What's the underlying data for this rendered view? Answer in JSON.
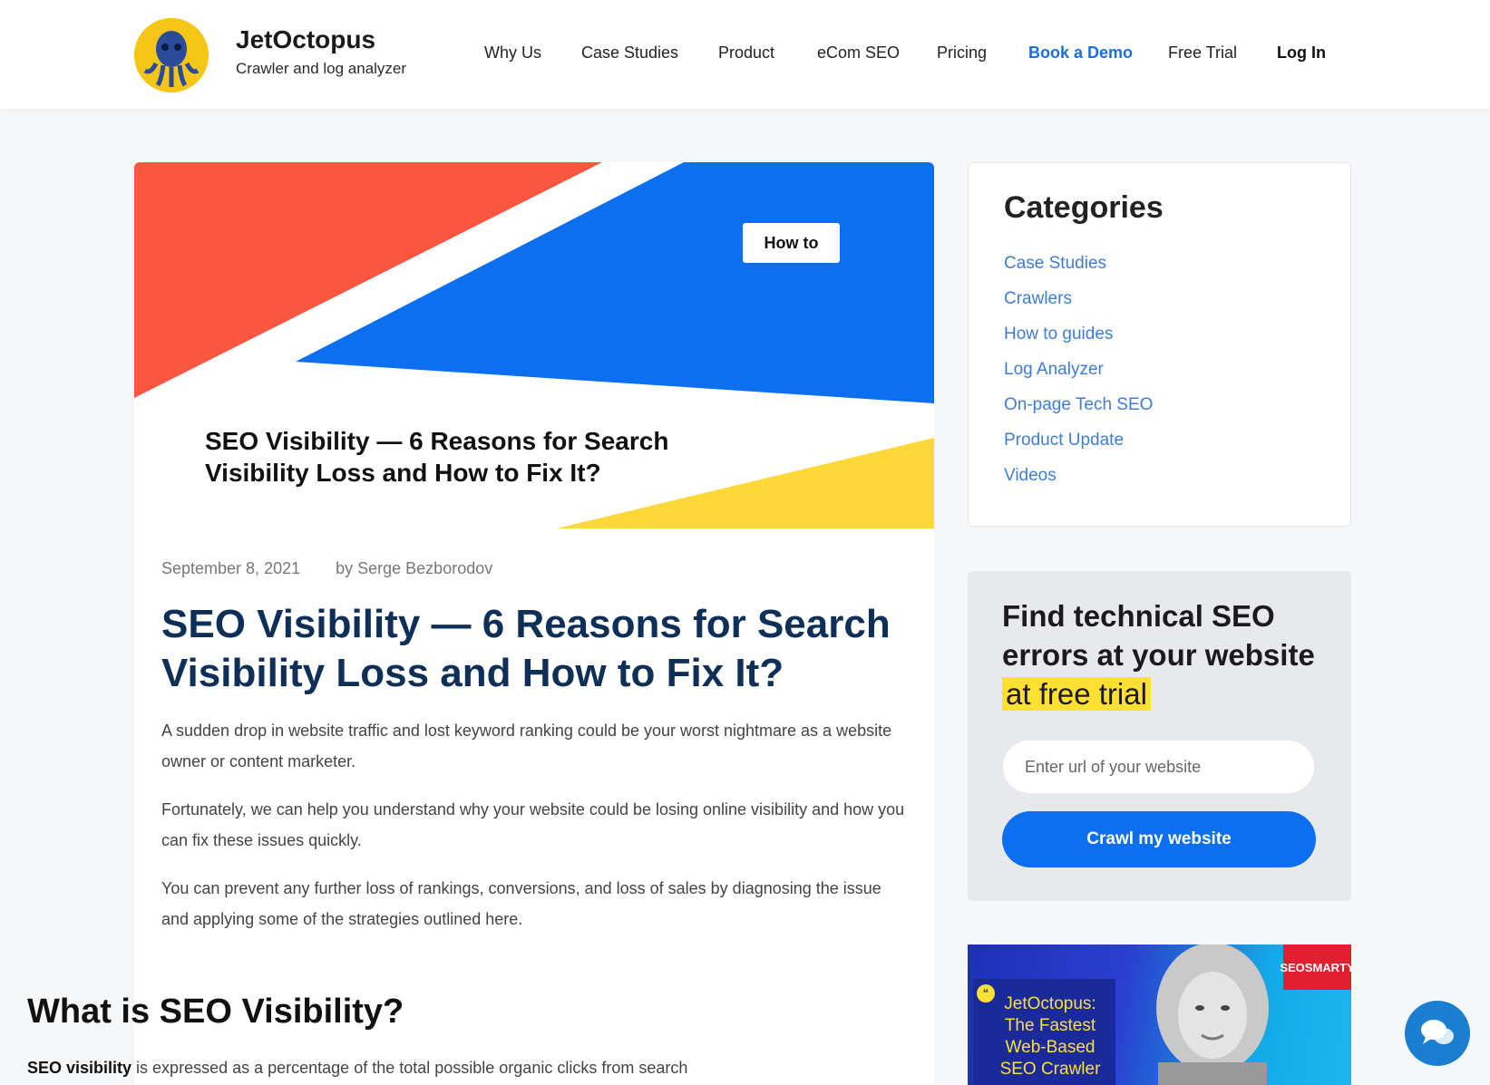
{
  "brand": {
    "name": "JetOctopus",
    "tagline": "Crawler and log analyzer"
  },
  "nav": {
    "items": [
      "Why Us",
      "Case Studies",
      "Product",
      "eCom SEO",
      "Pricing"
    ],
    "book_demo": "Book a Demo",
    "free_trial": "Free Trial",
    "log_in": "Log In"
  },
  "hero": {
    "badge": "How to",
    "title": "SEO Visibility — 6 Reasons for Search Visibility Loss and How to Fix It?"
  },
  "article": {
    "date": "September 8, 2021",
    "author": "by Serge Bezborodov",
    "title": "SEO Visibility — 6 Reasons for Search Visibility Loss and How to Fix It?",
    "paragraphs": [
      "A sudden drop in website traffic and lost keyword ranking could be your worst nightmare as a website owner or content marketer.",
      "Fortunately, we can help you understand why your website could be losing online visibility and how you can fix these issues quickly.",
      "You can prevent any further loss of rankings, conversions, and loss of sales by diagnosing the issue and applying some of the strategies outlined here."
    ],
    "h2": "What is SEO Visibility?",
    "last_bold": "SEO visibility",
    "last_rest": " is expressed as a percentage of the total possible organic clicks from search"
  },
  "categories": {
    "title": "Categories",
    "items": [
      "Case Studies",
      "Crawlers",
      "How to guides",
      "Log Analyzer",
      "On-page Tech SEO",
      "Product Update",
      "Videos"
    ]
  },
  "cta": {
    "title_1": "Find technical SEO errors at your website",
    "title_highlight": "at free trial",
    "placeholder": "Enter url of your website",
    "button": "Crawl my website"
  },
  "promo": {
    "text": "JetOctopus: The Fastest Web-Based SEO Crawler",
    "logo": "SEOSMARTY"
  },
  "colors": {
    "accent": "#0c6ff0",
    "title_navy": "#0e2f57",
    "highlight": "#fde031",
    "hero_red": "#fb5640",
    "hero_blue": "#0b6ff0",
    "hero_yellow": "#fed836"
  }
}
